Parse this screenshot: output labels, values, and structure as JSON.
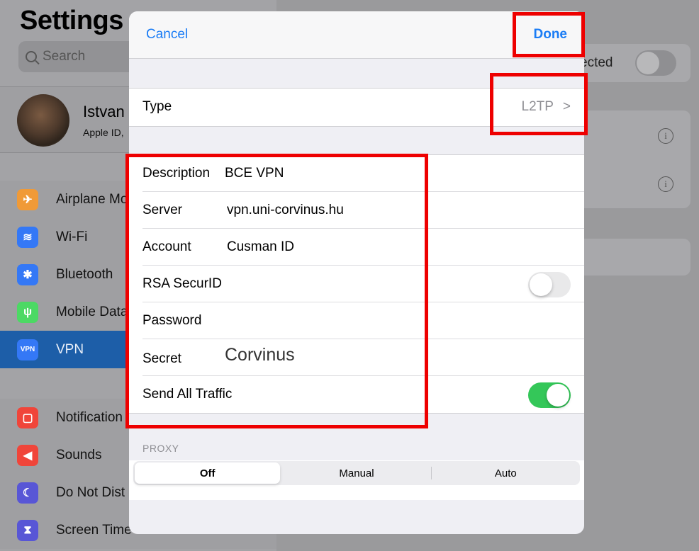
{
  "sidebar": {
    "title": "Settings",
    "search_placeholder": "Search",
    "profile": {
      "name": "Istvan",
      "subtitle": "Apple ID,"
    },
    "items_top": [
      {
        "label": "Airplane Mo",
        "color": "#f09a37",
        "icon": "airplane-icon",
        "glyph": "✈"
      },
      {
        "label": "Wi-Fi",
        "color": "#3478f6",
        "icon": "wifi-icon",
        "glyph": "≋"
      },
      {
        "label": "Bluetooth",
        "color": "#3478f6",
        "icon": "bluetooth-icon",
        "glyph": "✱"
      },
      {
        "label": "Mobile Data",
        "color": "#4cd964",
        "icon": "antenna-icon",
        "glyph": "ψ"
      },
      {
        "label": "VPN",
        "color": "#3478f6",
        "icon": "vpn-icon",
        "glyph": "VPN"
      }
    ],
    "items_bottom": [
      {
        "label": "Notification",
        "color": "#f0453a",
        "icon": "notifications-icon",
        "glyph": "▢"
      },
      {
        "label": "Sounds",
        "color": "#f0453a",
        "icon": "speaker-icon",
        "glyph": "◀"
      },
      {
        "label": "Do Not Dist",
        "color": "#5856d6",
        "icon": "moon-icon",
        "glyph": "☾"
      },
      {
        "label": "Screen Time",
        "color": "#5856d6",
        "icon": "hourglass-icon",
        "glyph": "⧗"
      }
    ]
  },
  "background_pane": {
    "status_text": "ected"
  },
  "modal": {
    "cancel_label": "Cancel",
    "done_label": "Done",
    "type": {
      "label": "Type",
      "value": "L2TP",
      "chevron": ">"
    },
    "fields": {
      "description": {
        "label": "Description",
        "value": "BCE VPN"
      },
      "server": {
        "label": "Server",
        "value": "vpn.uni-corvinus.hu"
      },
      "account": {
        "label": "Account",
        "value": "Cusman ID"
      },
      "rsa": {
        "label": "RSA SecurID",
        "on": false
      },
      "password": {
        "label": "Password",
        "value": ""
      },
      "secret": {
        "label": "Secret",
        "value": "Corvinus"
      },
      "send_all": {
        "label": "Send All Traffic",
        "on": true
      }
    },
    "proxy": {
      "label": "PROXY",
      "options": [
        "Off",
        "Manual",
        "Auto"
      ],
      "selected": "Off"
    }
  },
  "colors": {
    "accent": "#1a7cf5",
    "toggle_on": "#34c759",
    "annotation": "#ee0000"
  }
}
